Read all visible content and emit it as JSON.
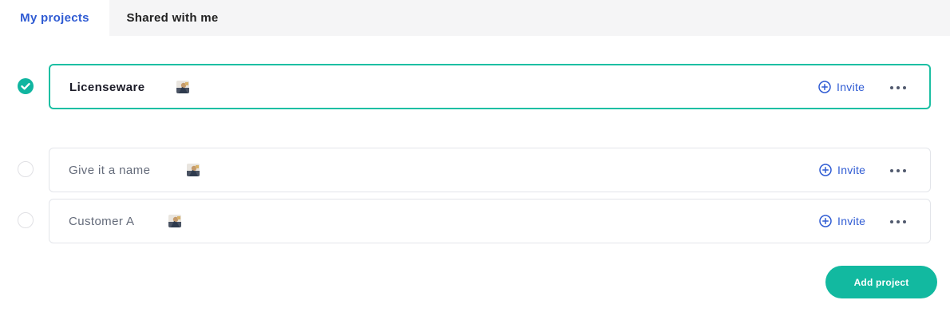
{
  "tabs": [
    {
      "label": "My projects",
      "active": true
    },
    {
      "label": "Shared with me",
      "active": false
    }
  ],
  "projects": [
    {
      "name": "Licenseware",
      "selected": true,
      "invite_label": "Invite"
    },
    {
      "name": "Give it a name",
      "selected": false,
      "invite_label": "Invite"
    },
    {
      "name": "Customer A",
      "selected": false,
      "invite_label": "Invite"
    }
  ],
  "add_project_label": "Add project",
  "colors": {
    "accent_blue": "#2f5bd3",
    "accent_teal": "#12b9a0",
    "selected_border": "#1dbfa3"
  },
  "icons": {
    "radio_checked": "check-circle-icon",
    "invite": "plus-circle-icon",
    "more": "more-horizontal-icon",
    "avatar": "user-avatar"
  }
}
